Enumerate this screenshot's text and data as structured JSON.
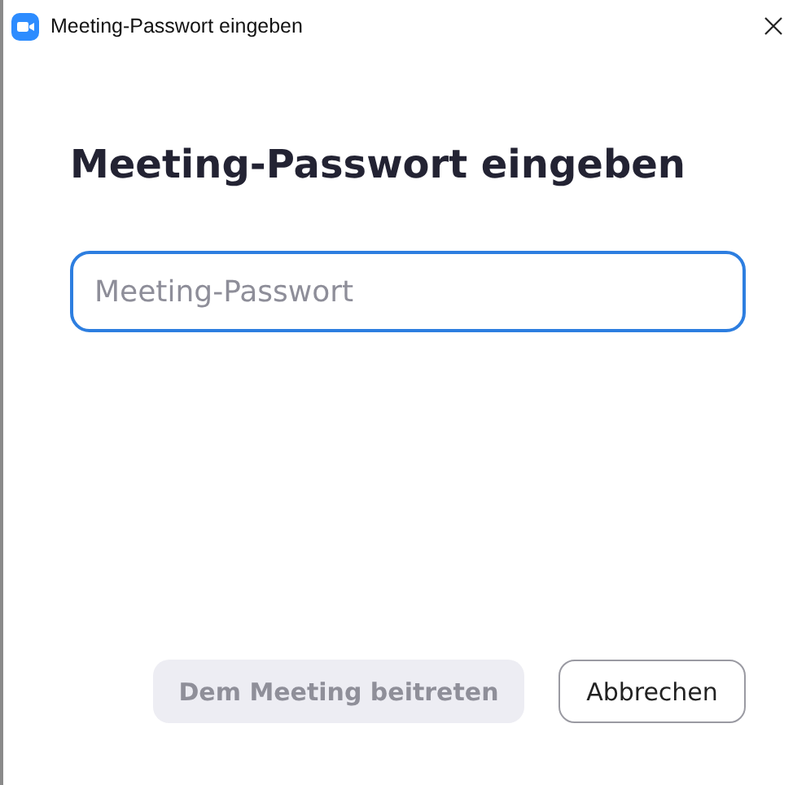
{
  "window": {
    "title": "Meeting-Passwort eingeben"
  },
  "heading": "Meeting-Passwort eingeben",
  "password_field": {
    "placeholder": "Meeting-Passwort",
    "focused": true
  },
  "buttons": [
    {
      "label": "Dem Meeting beitreten",
      "kind": "primary",
      "disabled": true
    },
    {
      "label": "Abbrechen",
      "kind": "secondary",
      "disabled": false
    }
  ]
}
